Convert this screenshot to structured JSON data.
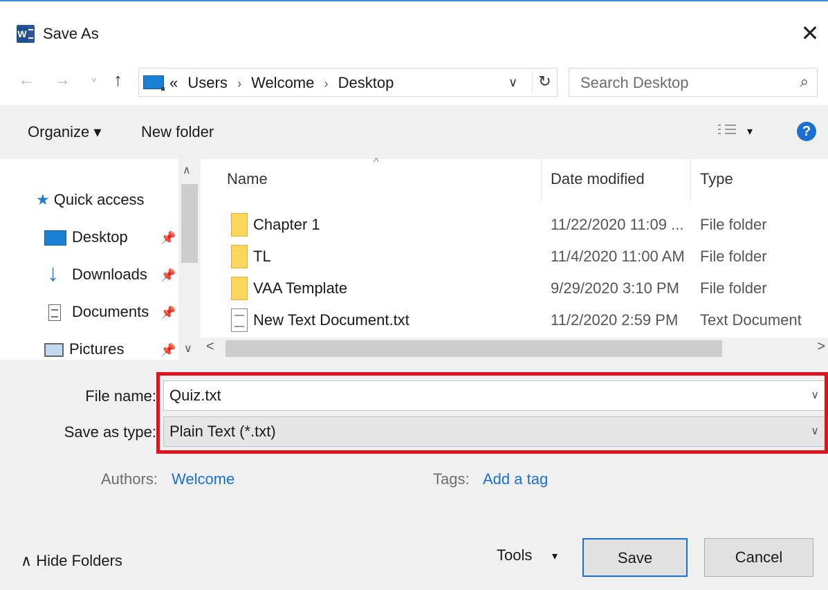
{
  "window": {
    "title": "Save As",
    "close_label": "✕",
    "app_icon": "word-icon"
  },
  "nav": {
    "back_icon": "←",
    "forward_icon": "→",
    "recent_icon": "˅",
    "up_icon": "↑",
    "breadcrumb_prefix": "«",
    "breadcrumb": [
      "Users",
      "Welcome",
      "Desktop"
    ],
    "breadcrumb_sep": "›",
    "dropdown_icon": "∨",
    "refresh_icon": "↻",
    "search_placeholder": "Search Desktop",
    "search_icon": "⌕"
  },
  "toolbar": {
    "organize_label": "Organize ▾",
    "new_folder_label": "New folder",
    "view_dropdown": "▾",
    "help_label": "?"
  },
  "navpane": {
    "quick_access": {
      "star": "★",
      "label": "Quick access"
    },
    "items": [
      {
        "label": "Desktop",
        "icon": "desktop-icon"
      },
      {
        "label": "Downloads",
        "icon": "downloads-icon"
      },
      {
        "label": "Documents",
        "icon": "documents-icon"
      },
      {
        "label": "Pictures",
        "icon": "pictures-icon"
      }
    ],
    "pin_glyph": "📌",
    "scroll_up": "∧",
    "scroll_down": "∨"
  },
  "filelist": {
    "sort_caret": "^",
    "columns": [
      "Name",
      "Date modified",
      "Type"
    ],
    "rows": [
      {
        "name": "Chapter 1",
        "date": "11/22/2020 11:09 ...",
        "type": "File folder",
        "kind": "folder"
      },
      {
        "name": "TL",
        "date": "11/4/2020 11:00 AM",
        "type": "File folder",
        "kind": "folder"
      },
      {
        "name": "VAA Template",
        "date": "9/29/2020 3:10 PM",
        "type": "File folder",
        "kind": "folder"
      },
      {
        "name": "New Text Document.txt",
        "date": "11/2/2020 2:59 PM",
        "type": "Text Document",
        "kind": "text"
      }
    ],
    "scroll_left": "<",
    "scroll_right": ">"
  },
  "form": {
    "file_name_label": "File name:",
    "file_name_value": "Quiz.txt",
    "save_type_label": "Save as type:",
    "save_type_value": "Plain Text (*.txt)",
    "dropdown_glyph": "∨",
    "authors_label": "Authors:",
    "authors_value": "Welcome",
    "tags_label": "Tags:",
    "tags_value": "Add a tag",
    "highlight_color": "#e0121c"
  },
  "footer": {
    "hide_folders_label": "∧  Hide Folders",
    "tools_label": "Tools",
    "tools_dropdown": "▾",
    "save_label": "Save",
    "cancel_label": "Cancel"
  },
  "colors": {
    "accent": "#1a6fd1",
    "pane_bg": "#f0f0f0",
    "folder": "#ffd65c"
  }
}
